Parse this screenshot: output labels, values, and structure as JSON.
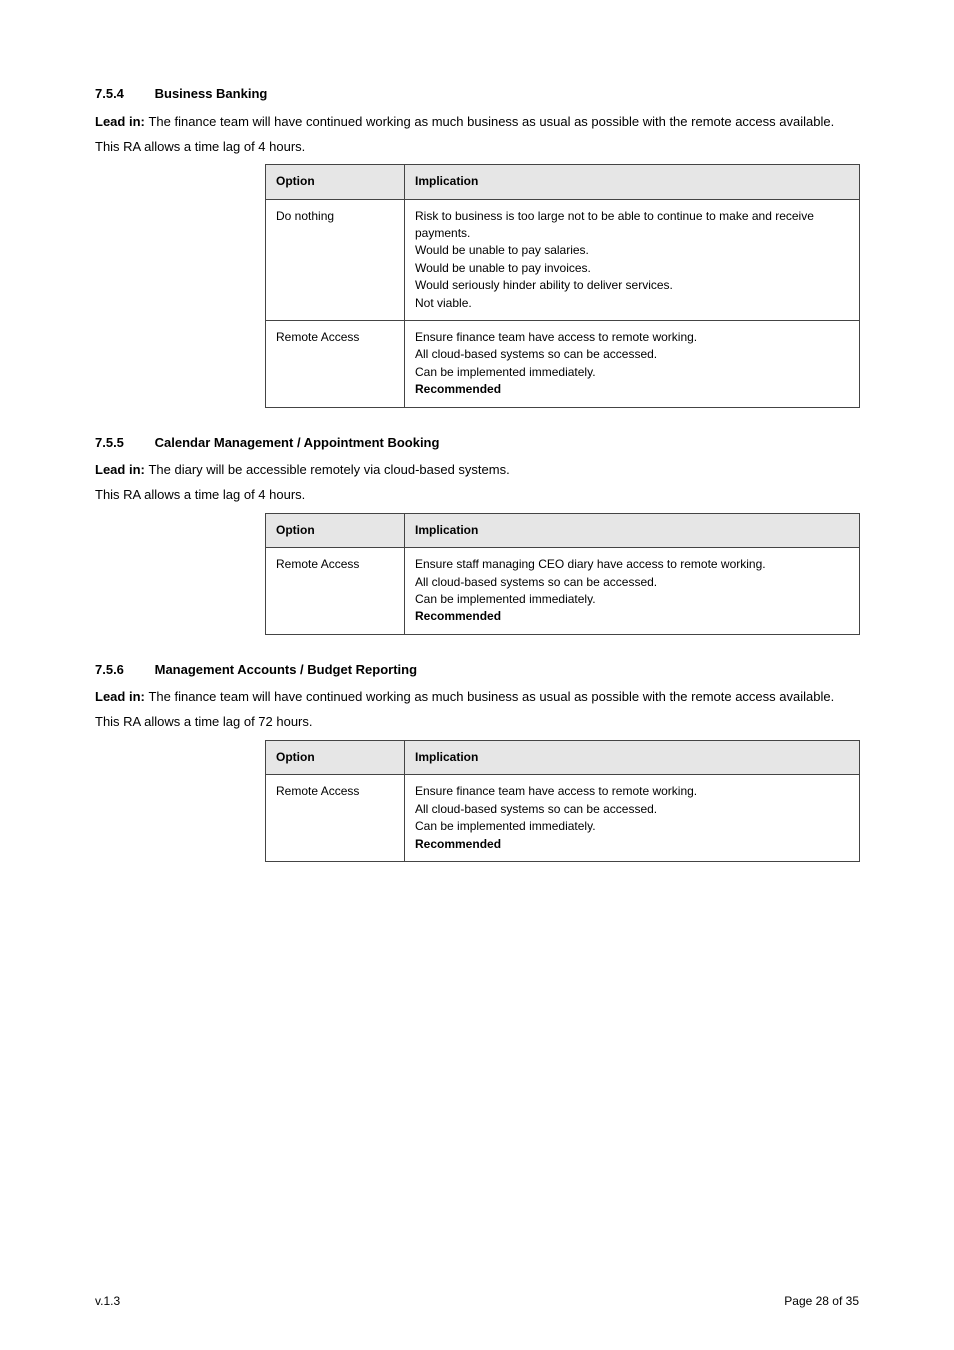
{
  "sections": [
    {
      "num": "7.5.4",
      "title": "Business Banking",
      "lead": "The finance team will have continued working as much business as usual as possible with the remote access available.",
      "body": "This RA allows a time lag of 4 hours.",
      "table": {
        "headers": [
          "Option",
          "Implication"
        ],
        "rows": [
          {
            "option": "Do nothing",
            "implication_lines": [
              "Risk to business is too large not to be able to continue to make and receive payments.",
              "Would be unable to pay salaries.",
              "Would be unable to pay invoices.",
              "Would seriously hinder ability to deliver services.",
              "Not viable."
            ]
          },
          {
            "option": "Remote Access",
            "implication_lines": [
              "Ensure finance team have access to remote working.",
              "All cloud-based systems so can be accessed.",
              "Can be implemented immediately.",
              "Recommended"
            ],
            "bold_last": true
          }
        ]
      }
    },
    {
      "num": "7.5.5",
      "title": "Calendar Management / Appointment Booking",
      "lead": "The diary will be accessible remotely via cloud-based systems.",
      "body": "This RA allows a time lag of 4 hours.",
      "table": {
        "headers": [
          "Option",
          "Implication"
        ],
        "rows": [
          {
            "option": "Remote Access",
            "implication_lines": [
              "Ensure staff managing CEO diary have access to remote working.",
              "All cloud-based systems so can be accessed.",
              "Can be implemented immediately.",
              "Recommended"
            ],
            "bold_last": true
          }
        ]
      }
    },
    {
      "num": "7.5.6",
      "title": "Management Accounts / Budget Reporting",
      "lead": "The finance team will have continued working as much business as usual as possible with the remote access available.",
      "body": "This RA allows a time lag of 72 hours.",
      "table": {
        "headers": [
          "Option",
          "Implication"
        ],
        "rows": [
          {
            "option": "Remote Access",
            "implication_lines": [
              "Ensure finance team have access to remote working.",
              "All cloud-based systems so can be accessed.",
              "Can be implemented immediately.",
              "Recommended"
            ],
            "bold_last": true
          }
        ]
      }
    }
  ],
  "footer": {
    "left": "v.1.3",
    "right": "Page 28 of 35"
  }
}
